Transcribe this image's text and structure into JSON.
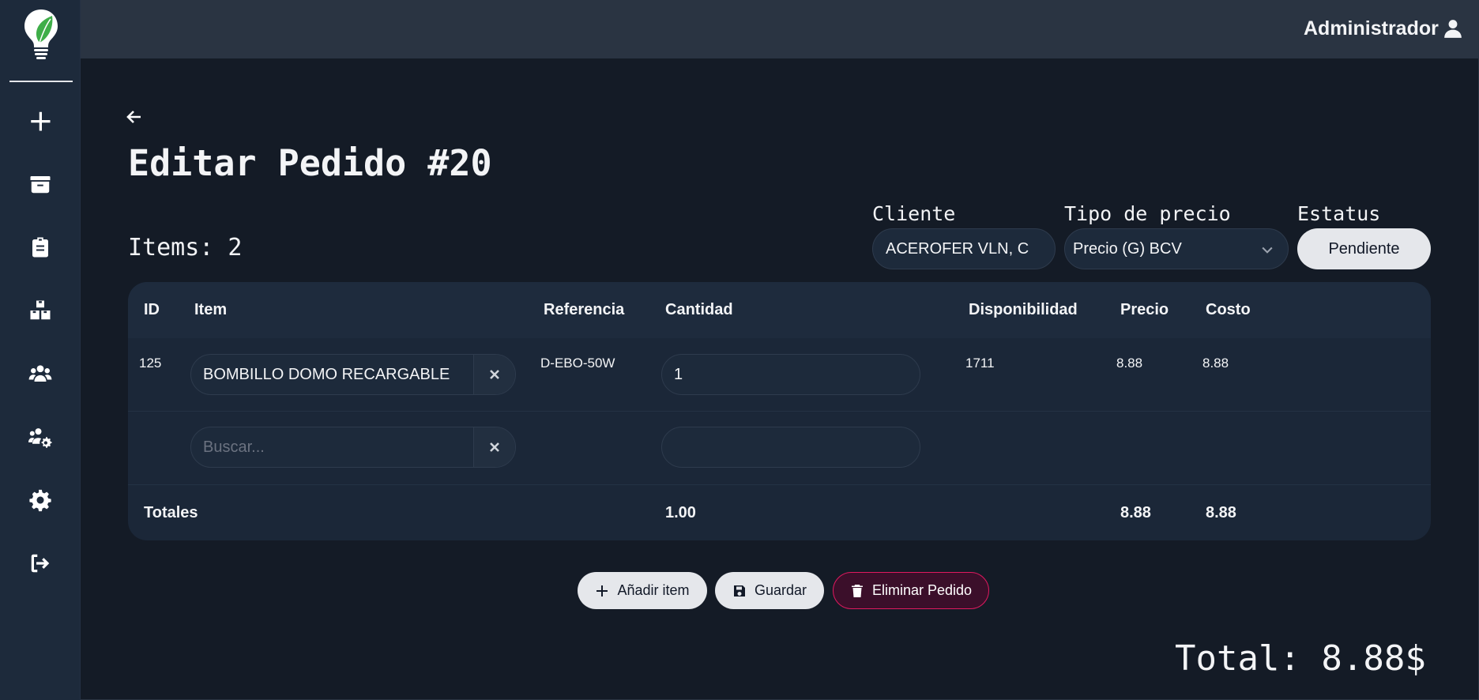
{
  "header": {
    "user_name": "Administrador",
    "user_icon": "user-icon",
    "theme_icon": "moon-icon"
  },
  "sidebar": {
    "items": [
      {
        "icon": "plus-icon"
      },
      {
        "icon": "box-icon"
      },
      {
        "icon": "clipboard-icon"
      },
      {
        "icon": "boxes-icon"
      },
      {
        "icon": "users-icon"
      },
      {
        "icon": "users-gear-icon"
      },
      {
        "icon": "gear-icon"
      },
      {
        "icon": "logout-icon"
      }
    ]
  },
  "page": {
    "title": "Editar Pedido #20",
    "items_label": "Items: 2"
  },
  "fields": {
    "cliente_label": "Cliente",
    "cliente_value": "ACEROFER VLN, C",
    "tipo_label": "Tipo de precio",
    "tipo_value": "Precio (G) BCV",
    "estatus_label": "Estatus",
    "estatus_value": "Pendiente"
  },
  "table": {
    "headers": [
      "ID",
      "Item",
      "Referencia",
      "Cantidad",
      "Disponibilidad",
      "Precio",
      "Costo"
    ],
    "rows": [
      {
        "id": "125",
        "item": "BOMBILLO DOMO RECARGABLE",
        "referencia": "D-EBO-50W",
        "cantidad": "1",
        "disponibilidad": "1711",
        "precio": "8.88",
        "costo": "8.88"
      }
    ],
    "new_row": {
      "item_placeholder": "Buscar...",
      "cantidad": ""
    },
    "totals": {
      "label": "Totales",
      "cantidad": "1.00",
      "precio": "8.88",
      "costo": "8.88"
    }
  },
  "actions": {
    "add_label": "Añadir item",
    "save_label": "Guardar",
    "delete_label": "Eliminar Pedido"
  },
  "grand_total": "Total: 8.88$",
  "colors": {
    "background": "#141b26",
    "sidebar": "#1d2a3b",
    "header": "#2a3442",
    "danger": "#e0195f"
  }
}
